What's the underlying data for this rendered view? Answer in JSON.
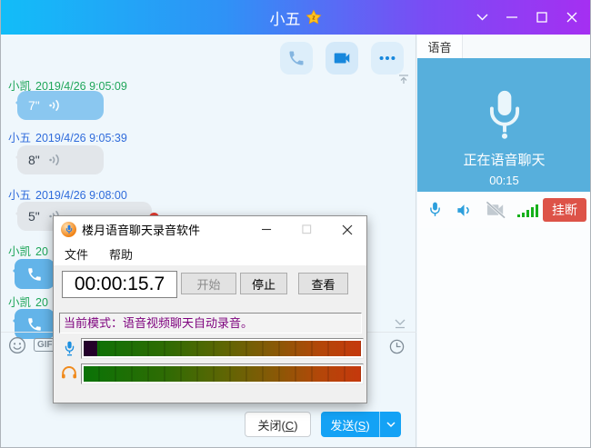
{
  "titlebar": {
    "title": "小五",
    "badge_letter": "z"
  },
  "chat": {
    "messages": [
      {
        "kind": "header",
        "sender": "小凯",
        "time": "2019/4/26 9:05:09"
      },
      {
        "kind": "voice",
        "bubble": "blue",
        "duration": "7\""
      },
      {
        "kind": "header",
        "sender": "小五",
        "time": "2019/4/26 9:05:39"
      },
      {
        "kind": "voice",
        "bubble": "gray",
        "duration": "8\""
      },
      {
        "kind": "header",
        "sender": "小五",
        "time": "2019/4/26 9:08:00"
      },
      {
        "kind": "voice",
        "bubble": "gray",
        "duration": "5\"",
        "unread": true
      },
      {
        "kind": "header",
        "sender": "小凯",
        "time": "20"
      },
      {
        "kind": "call"
      },
      {
        "kind": "header",
        "sender": "小凯",
        "time": "20"
      },
      {
        "kind": "call"
      }
    ],
    "input_bar": {
      "gif": "GIF"
    },
    "footer": {
      "close_pre": "关闭(",
      "close_key": "C",
      "close_post": ")",
      "send_pre": "发送(",
      "send_key": "S",
      "send_post": ")"
    }
  },
  "voice_panel": {
    "tab": "语音",
    "calling": "正在语音聊天",
    "duration": "00:15",
    "hangup": "挂断"
  },
  "recorder": {
    "title": "楼月语音聊天录音软件",
    "menu": {
      "file": "文件",
      "help": "帮助"
    },
    "timer": "00:00:15.7",
    "buttons": {
      "start": "开始",
      "stop": "停止",
      "view": "查看"
    },
    "status": "当前模式：语音视频聊天自动录音。"
  },
  "colors": {
    "titlebar_gradient_left": "#12BDF8",
    "titlebar_gradient_right": "#A52FF2",
    "chat_bg": "#EFF7FC",
    "bubble_blue": "#8AC7F0",
    "bubble_gray": "#E2E6EA",
    "sender_green": "#1FA65A",
    "sender_blue": "#2F6BDB",
    "panel_blue": "#57AFDC",
    "hangup_red": "#DD5348",
    "send_blue": "#14A2F5",
    "status_purple": "#7D007D",
    "meter_green": "#0A7306",
    "meter_red": "#C5380C",
    "meter_dark_head": "#24002A",
    "signal_green": "#15B01A",
    "unread_red": "#E23B30"
  }
}
